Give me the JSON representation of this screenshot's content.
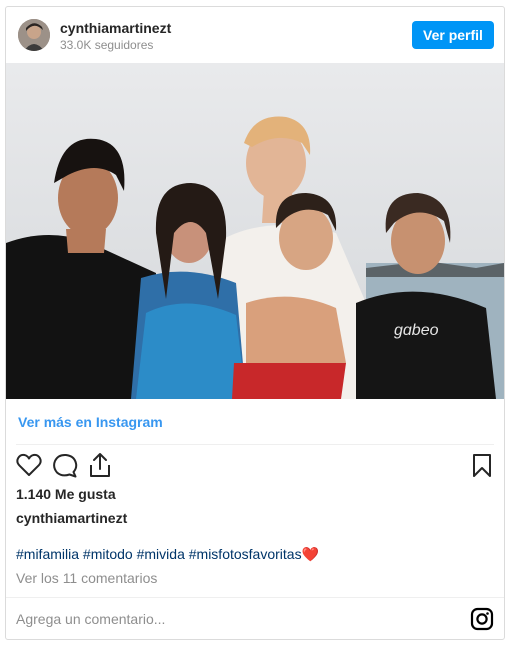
{
  "header": {
    "username": "cynthiamartinezt",
    "followers": "33.0K seguidores",
    "profile_button": "Ver perfil"
  },
  "post": {
    "more_link": "Ver más en Instagram",
    "likes": "1.140 Me gusta",
    "caption_user": "cynthiamartinezt",
    "hashtags": [
      "#mifamilia",
      "#mitodo",
      "#mivida",
      "#misfotosfavoritas"
    ],
    "hashtag_emoji": "❤️",
    "comments_link": "Ver los 11 comentarios"
  },
  "comment": {
    "placeholder": "Agrega un comentario..."
  },
  "icons": {
    "like": "heart-icon",
    "comment": "comment-icon",
    "share": "share-icon",
    "save": "bookmark-icon",
    "instagram": "instagram-icon"
  },
  "colors": {
    "accent": "#0095f6",
    "link": "#3897f0",
    "hashtag": "#003569",
    "muted": "#8e8e8e"
  }
}
